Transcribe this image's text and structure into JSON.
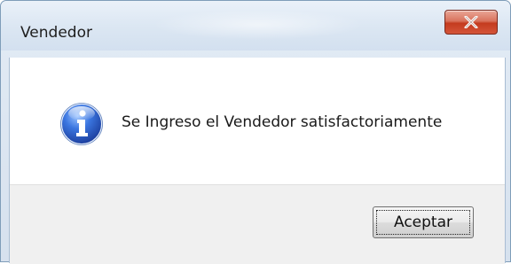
{
  "window": {
    "title": "Vendedor"
  },
  "controls": {
    "close_icon": "close-x-icon"
  },
  "dialog": {
    "icon": "information-icon",
    "message": "Se Ingreso el Vendedor satisfactoriamente",
    "ok_label": "Aceptar"
  },
  "colors": {
    "close_button": "#c43b1f",
    "info_icon": "#2a5cc5"
  }
}
